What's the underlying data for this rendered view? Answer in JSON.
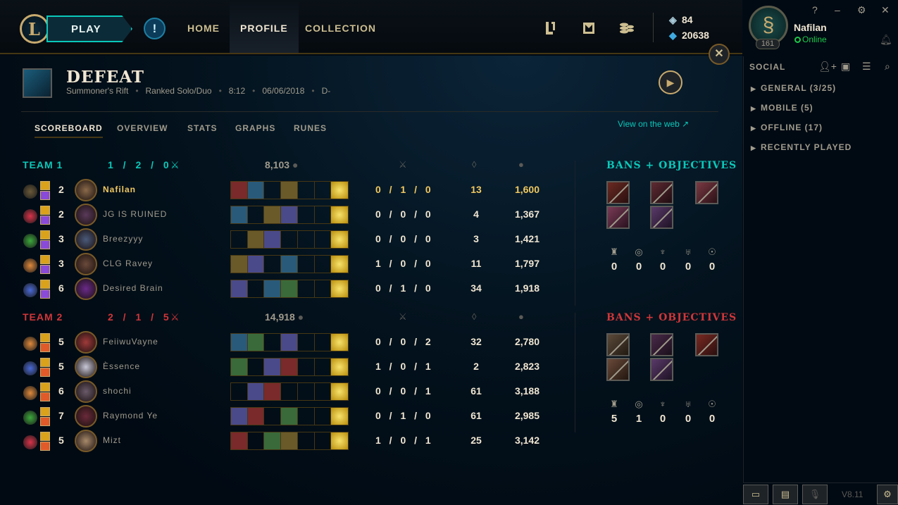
{
  "nav": {
    "play_label": "PLAY",
    "alert_glyph": "!",
    "tabs": [
      "HOME",
      "PROFILE",
      "COLLECTION"
    ],
    "icons": [
      "clash-icon",
      "loot-icon",
      "store-icon"
    ],
    "rp": "84",
    "be": "20638"
  },
  "profile": {
    "name": "Nafilan",
    "status": "Online",
    "level": "161",
    "window_controls": [
      "?",
      "–",
      "⚙",
      "✕"
    ]
  },
  "social": {
    "title": "SOCIAL",
    "groups": [
      "GENERAL (3/25)",
      "MOBILE (5)",
      "OFFLINE (17)",
      "RECENTLY PLAYED"
    ]
  },
  "match": {
    "result": "DEFEAT",
    "map": "Summoner's Rift",
    "queue": "Ranked Solo/Duo",
    "duration": "8:12",
    "date": "06/06/2018",
    "rank": "D-",
    "close_glyph": "✕",
    "replay_glyph": "▶"
  },
  "subtabs": [
    "SCOREBOARD",
    "OVERVIEW",
    "STATS",
    "GRAPHS",
    "RUNES"
  ],
  "view_web": "View on the web ↗",
  "teams": [
    {
      "name": "TEAM 1",
      "kda": "1 / 2 / 0",
      "gold": "8,103",
      "bans_title": "BANS + OBJECTIVES",
      "objectives": [
        "0",
        "0",
        "0",
        "0",
        "0"
      ],
      "players": [
        {
          "level": "2",
          "name": "Nafilan",
          "kda": "0 / 1 / 0",
          "cs": "13",
          "gold": "1,600",
          "me": true
        },
        {
          "level": "2",
          "name": "JG IS RUINED",
          "kda": "0 / 0 / 0",
          "cs": "4",
          "gold": "1,367"
        },
        {
          "level": "3",
          "name": "Breezyyy",
          "kda": "0 / 0 / 0",
          "cs": "3",
          "gold": "1,421"
        },
        {
          "level": "3",
          "name": "CLG Ravey",
          "kda": "1 / 0 / 0",
          "cs": "11",
          "gold": "1,797"
        },
        {
          "level": "6",
          "name": "Desired Brain",
          "kda": "0 / 1 / 0",
          "cs": "34",
          "gold": "1,918"
        }
      ]
    },
    {
      "name": "TEAM 2",
      "kda": "2 / 1 / 5",
      "gold": "14,918",
      "bans_title": "BANS + OBJECTIVES",
      "objectives": [
        "5",
        "1",
        "0",
        "0",
        "0"
      ],
      "players": [
        {
          "level": "5",
          "name": "FeiiwuVayne",
          "kda": "0 / 0 / 2",
          "cs": "32",
          "gold": "2,780"
        },
        {
          "level": "5",
          "name": "Èssence",
          "kda": "1 / 0 / 1",
          "cs": "2",
          "gold": "2,823"
        },
        {
          "level": "6",
          "name": "shochi",
          "kda": "0 / 0 / 1",
          "cs": "61",
          "gold": "3,188"
        },
        {
          "level": "7",
          "name": "Raymond Ye",
          "kda": "0 / 1 / 0",
          "cs": "61",
          "gold": "2,985"
        },
        {
          "level": "5",
          "name": "Mizt",
          "kda": "1 / 0 / 1",
          "cs": "25",
          "gold": "3,142"
        }
      ]
    }
  ],
  "objective_icons": [
    "tower-icon",
    "inhibitor-icon",
    "baron-icon",
    "dragon-icon",
    "herald-icon"
  ],
  "footer": {
    "version": "V8.11"
  },
  "colors": {
    "team1": "#0ac8b9",
    "team2": "#d13639",
    "gold": "#c8aa6e",
    "highlight": "#f0c860"
  }
}
